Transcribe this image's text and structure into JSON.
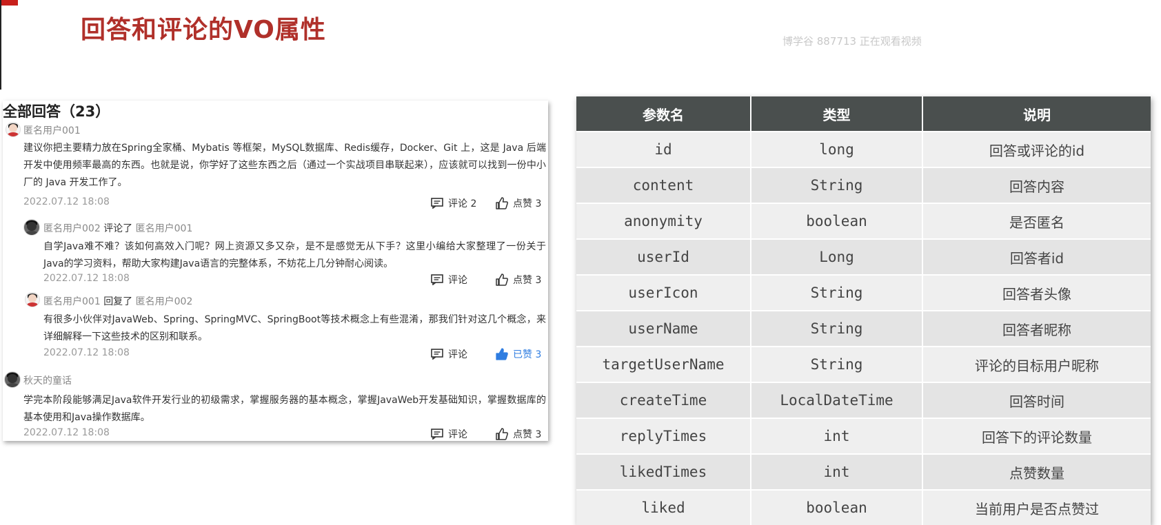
{
  "slide": {
    "title": "回答和评论的VO属性",
    "watermark": "博学谷 887713 正在观看视频"
  },
  "comments_panel": {
    "title": "全部回答（23）",
    "comments": [
      {
        "user": "匿名用户001",
        "verb": "",
        "target": "",
        "content": "建议你把主要精力放在Spring全家桶、Mybatis 等框架，MySQL数据库、Redis缓存，Docker、Git 上，这是 Java 后端开发中使用频率最高的东西。也就是说，你学好了这些东西之后（通过一个实战项目串联起来），应该就可以找到一份中小厂的 Java 开发工作了。",
        "date": "2022.07.12  18:08",
        "comment_label": "评论 2",
        "like_label": "点赞 3",
        "liked": false
      },
      {
        "user": "匿名用户002",
        "verb": "评论了",
        "target": "匿名用户001",
        "content": "自学Java难不难？该如何高效入门呢？网上资源又多又杂，是不是感觉无从下手？这里小编给大家整理了一份关于Java的学习资料，帮助大家构建Java语言的完整体系，不妨花上几分钟耐心阅读。",
        "date": "2022.07.12  18:08",
        "comment_label": "评论",
        "like_label": "点赞 3",
        "liked": false
      },
      {
        "user": "匿名用户001",
        "verb": "回复了",
        "target": "匿名用户002",
        "content": "有很多小伙伴对JavaWeb、Spring、SpringMVC、SpringBoot等技术概念上有些混淆，那我们针对这几个概念，来详细解释一下这些技术的区别和联系。",
        "date": "2022.07.12  18:08",
        "comment_label": "评论",
        "like_label": "已赞 3",
        "liked": true
      },
      {
        "user": "秋天的童话",
        "verb": "",
        "target": "",
        "content": "学完本阶段能够满足Java软件开发行业的初级需求，掌握服务器的基本概念，掌握JavaWeb开发基础知识，掌握数据库的基本使用和Java操作数据库。",
        "date": "2022.07.12  18:08",
        "comment_label": "评论",
        "like_label": "点赞 3",
        "liked": false
      }
    ]
  },
  "vo_table": {
    "headers": [
      "参数名",
      "类型",
      "说明"
    ],
    "rows": [
      {
        "name": "id",
        "type": "long",
        "desc": "回答或评论的id"
      },
      {
        "name": "content",
        "type": "String",
        "desc": "回答内容"
      },
      {
        "name": "anonymity",
        "type": "boolean",
        "desc": "是否匿名"
      },
      {
        "name": "userId",
        "type": "Long",
        "desc": "回答者id"
      },
      {
        "name": "userIcon",
        "type": "String",
        "desc": "回答者头像"
      },
      {
        "name": "userName",
        "type": "String",
        "desc": "回答者昵称"
      },
      {
        "name": "targetUserName",
        "type": "String",
        "desc": "评论的目标用户昵称"
      },
      {
        "name": "createTime",
        "type": "LocalDateTime",
        "desc": "回答时间"
      },
      {
        "name": "replyTimes",
        "type": "int",
        "desc": "回答下的评论数量"
      },
      {
        "name": "likedTimes",
        "type": "int",
        "desc": "点赞数量"
      },
      {
        "name": "liked",
        "type": "boolean",
        "desc": "当前用户是否点赞过"
      }
    ]
  },
  "colors": {
    "title": "#b0302a",
    "table_header_bg": "#4a4f4e",
    "liked_blue": "#2f7de1"
  }
}
